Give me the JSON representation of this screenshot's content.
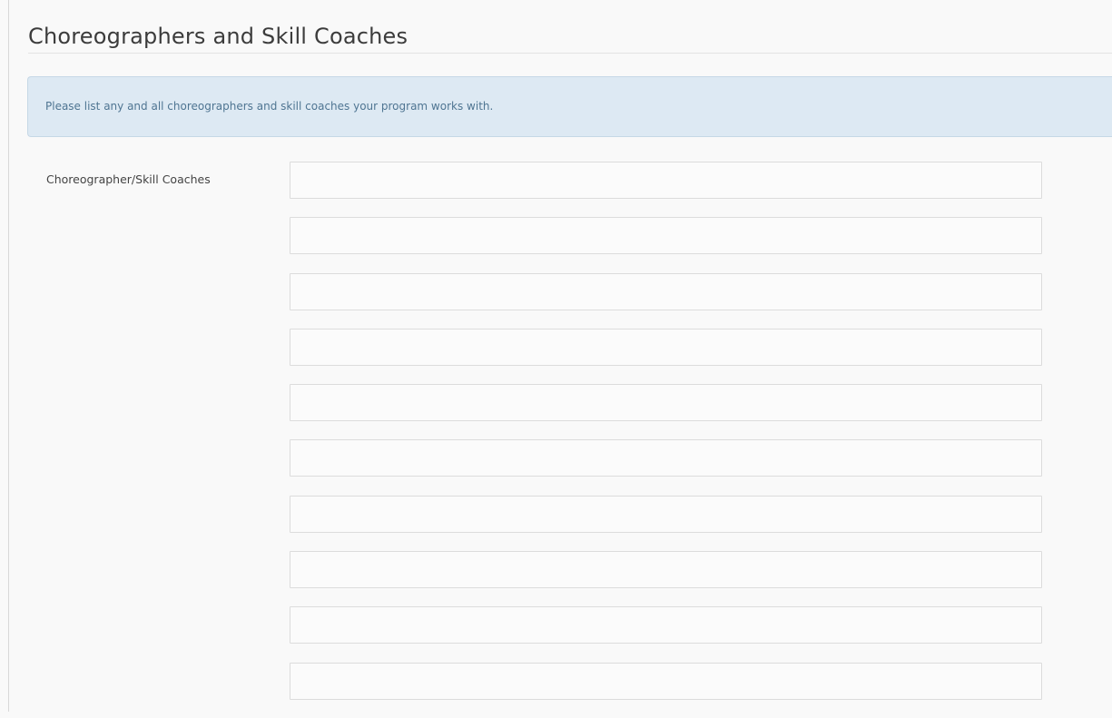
{
  "page": {
    "title": "Choreographers and Skill Coaches"
  },
  "alert": {
    "text": "Please list any and all choreographers and skill coaches your program works with."
  },
  "form": {
    "label": "Choreographer/Skill Coaches",
    "inputs": [
      {
        "value": "",
        "placeholder": ""
      },
      {
        "value": "",
        "placeholder": ""
      },
      {
        "value": "",
        "placeholder": ""
      },
      {
        "value": "",
        "placeholder": ""
      },
      {
        "value": "",
        "placeholder": ""
      },
      {
        "value": "",
        "placeholder": ""
      },
      {
        "value": "",
        "placeholder": ""
      },
      {
        "value": "",
        "placeholder": ""
      },
      {
        "value": "",
        "placeholder": ""
      },
      {
        "value": "",
        "placeholder": ""
      }
    ]
  },
  "colors": {
    "background": "#f9f9f9",
    "alert_background": "#dde9f3",
    "alert_text": "#4f7592",
    "input_border": "#dcdcdc"
  }
}
